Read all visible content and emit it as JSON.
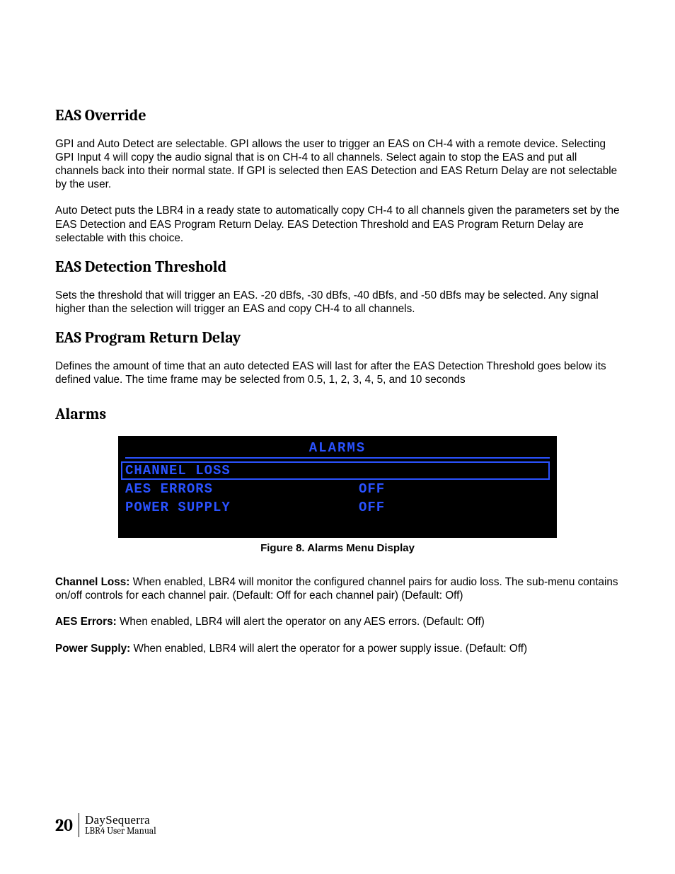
{
  "sections": {
    "s1": {
      "heading": "EAS Override",
      "p1": "GPI and Auto Detect are selectable.  GPI allows the user to trigger an EAS on CH-4 with a remote device.  Selecting GPI Input 4 will copy the audio signal that is on CH-4 to all channels.  Select again to stop the EAS and put all channels back into their normal state.  If GPI is selected then EAS Detection and EAS Return Delay are not selectable by the user.",
      "p2": "Auto Detect puts the LBR4 in a ready state to automatically copy CH-4 to all channels given the parameters set by the EAS Detection and EAS Program Return Delay.  EAS Detection Threshold and EAS Program Return Delay are selectable with this choice."
    },
    "s2": {
      "heading": "EAS Detection Threshold",
      "p1": "Sets the threshold that will trigger an EAS.  -20 dBfs, -30 dBfs, -40 dBfs, and -50 dBfs may be selected.  Any signal higher than the selection will trigger an EAS and copy CH-4 to all channels."
    },
    "s3": {
      "heading": "EAS Program Return Delay",
      "p1": "Defines the amount of time that an auto detected EAS will last for after the EAS Detection Threshold goes below its defined value.  The time frame may be selected from 0.5, 1, 2, 3, 4, 5, and 10 seconds"
    },
    "s4": {
      "heading": "Alarms",
      "caption": "Figure 8.    Alarms Menu Display",
      "desc": {
        "d1_term": "Channel Loss:",
        "d1_text": "  When enabled, LBR4 will monitor the configured channel pairs for audio loss. The sub-menu contains on/off controls for each channel pair. (Default: Off for each channel pair) (Default: Off)",
        "d2_term": "AES Errors:",
        "d2_text": " When enabled, LBR4 will alert the operator on any AES errors. (Default: Off)",
        "d3_term": "Power Supply:",
        "d3_text": " When enabled, LBR4 will alert the operator for a power supply issue. (Default: Off)"
      }
    }
  },
  "menu": {
    "title": "ALARMS",
    "rows": [
      {
        "label": "CHANNEL LOSS",
        "value": "",
        "selected": true
      },
      {
        "label": "AES ERRORS",
        "value": "OFF",
        "selected": false
      },
      {
        "label": "POWER SUPPLY",
        "value": "OFF",
        "selected": false
      }
    ]
  },
  "footer": {
    "page": "20",
    "brand": "DaySequerra",
    "manual": "LBR4 User Manual"
  }
}
